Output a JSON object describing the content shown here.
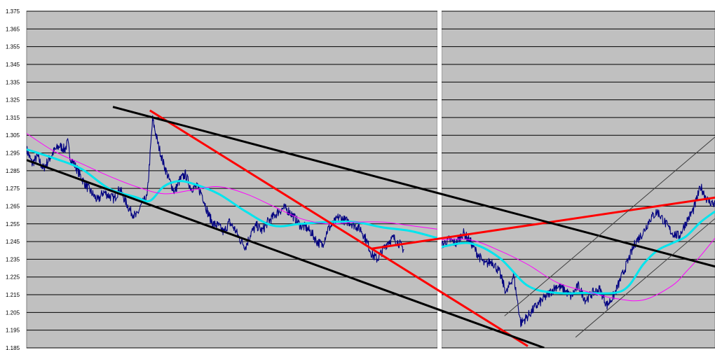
{
  "chart_data": {
    "type": "line",
    "title": "",
    "xlabel": "",
    "ylabel": "",
    "ylim": [
      1.185,
      1.375
    ],
    "y_ticks": [
      "1.375",
      "1.365",
      "1.355",
      "1.345",
      "1.335",
      "1.325",
      "1.315",
      "1.305",
      "1.295",
      "1.285",
      "1.275",
      "1.265",
      "1.255",
      "1.245",
      "1.235",
      "1.225",
      "1.215",
      "1.205",
      "1.195",
      "1.185"
    ],
    "grid": true,
    "legend": "none",
    "colors": {
      "plot_background": "#c0c0c0",
      "price": "#000080",
      "fast_average": "#00e5ee",
      "slow_average": "#ff00ff",
      "trendline_red": "#ff0000",
      "trendline_black": "#000000",
      "channel_thin": "#404040"
    },
    "panels": [
      {
        "name": "",
        "series": [
          {
            "role": "price",
            "x": [
              0,
              4,
              8,
              12,
              16,
              20,
              24,
              28,
              30,
              32,
              36,
              40,
              44,
              48,
              52,
              56,
              60,
              64,
              68,
              72,
              76,
              80,
              84,
              88,
              92,
              96,
              100,
              104,
              108,
              112,
              116,
              120,
              124,
              128,
              132,
              136,
              140,
              144,
              148,
              152,
              156,
              160,
              164,
              168,
              172,
              176,
              180,
              184,
              188,
              192,
              196,
              200,
              204,
              208,
              212,
              216,
              220,
              224,
              228,
              232,
              236,
              240,
              244,
              248,
              252,
              256,
              260,
              264,
              268,
              272,
              276,
              280,
              284,
              288,
              292,
              296,
              300
            ],
            "y": [
              1.297,
              1.289,
              1.293,
              1.286,
              1.291,
              1.296,
              1.299,
              1.297,
              1.301,
              1.292,
              1.287,
              1.281,
              1.276,
              1.272,
              1.268,
              1.273,
              1.271,
              1.269,
              1.275,
              1.268,
              1.262,
              1.259,
              1.266,
              1.27,
              1.314,
              1.3,
              1.289,
              1.28,
              1.273,
              1.28,
              1.283,
              1.275,
              1.276,
              1.272,
              1.262,
              1.255,
              1.254,
              1.25,
              1.256,
              1.252,
              1.246,
              1.242,
              1.25,
              1.254,
              1.251,
              1.256,
              1.259,
              1.262,
              1.264,
              1.262,
              1.258,
              1.254,
              1.253,
              1.25,
              1.245,
              1.243,
              1.252,
              1.255,
              1.259,
              1.257,
              1.256,
              1.254,
              1.252,
              1.246,
              1.238,
              1.235,
              1.24,
              1.245,
              1.247,
              1.244,
              1.24
            ]
          },
          {
            "role": "fast-average",
            "x": [
              0,
              20,
              40,
              60,
              80,
              90,
              100,
              110,
              120,
              140,
              160,
              180,
              200,
              220,
              240,
              260,
              280,
              300
            ],
            "y": [
              1.297,
              1.292,
              1.286,
              1.275,
              1.27,
              1.268,
              1.276,
              1.279,
              1.278,
              1.272,
              1.262,
              1.254,
              1.255,
              1.256,
              1.256,
              1.253,
              1.251,
              1.247
            ]
          },
          {
            "role": "slow-average",
            "x": [
              0,
              20,
              40,
              60,
              80,
              100,
              120,
              140,
              160,
              180,
              200,
              220,
              240,
              260,
              280,
              300
            ],
            "y": [
              1.306,
              1.296,
              1.289,
              1.282,
              1.276,
              1.272,
              1.274,
              1.276,
              1.272,
              1.265,
              1.258,
              1.255,
              1.256,
              1.256,
              1.254,
              1.252
            ]
          }
        ]
      },
      {
        "name": "",
        "series": [
          {
            "role": "price",
            "x": [
              0,
              5,
              10,
              15,
              20,
              25,
              30,
              35,
              40,
              45,
              50,
              55,
              60,
              65,
              70,
              75,
              80,
              85,
              90,
              95,
              100,
              105,
              110,
              115,
              120,
              125,
              130,
              135,
              140,
              145,
              150,
              155,
              160,
              165,
              170,
              175,
              180,
              185,
              190
            ],
            "y": [
              1.243,
              1.246,
              1.244,
              1.25,
              1.245,
              1.238,
              1.232,
              1.234,
              1.228,
              1.216,
              1.226,
              1.199,
              1.203,
              1.208,
              1.212,
              1.216,
              1.22,
              1.218,
              1.214,
              1.22,
              1.212,
              1.216,
              1.218,
              1.209,
              1.215,
              1.225,
              1.235,
              1.245,
              1.25,
              1.258,
              1.262,
              1.256,
              1.25,
              1.248,
              1.256,
              1.263,
              1.276,
              1.268,
              1.266
            ]
          },
          {
            "role": "fast-average",
            "x": [
              0,
              20,
              40,
              60,
              80,
              100,
              120,
              130,
              140,
              150,
              160,
              170,
              180,
              190
            ],
            "y": [
              1.242,
              1.244,
              1.236,
              1.22,
              1.216,
              1.216,
              1.216,
              1.22,
              1.232,
              1.24,
              1.244,
              1.248,
              1.256,
              1.262
            ]
          },
          {
            "role": "slow-average",
            "x": [
              0,
              20,
              40,
              60,
              80,
              100,
              120,
              140,
              160,
              170,
              180,
              190
            ],
            "y": [
              1.246,
              1.246,
              1.24,
              1.232,
              1.222,
              1.217,
              1.213,
              1.212,
              1.22,
              1.228,
              1.237,
              1.247
            ]
          }
        ]
      }
    ],
    "annotations": [
      {
        "type": "trendline",
        "color": "red",
        "panel": "left",
        "from": [
          0.3,
          1.319
        ],
        "to": [
          1.22,
          1.186
        ]
      },
      {
        "type": "trendline",
        "color": "red",
        "panel": "left",
        "from": [
          0.84,
          1.241
        ],
        "to": [
          2.0,
          1.281
        ]
      },
      {
        "type": "trendline",
        "color": "black",
        "panel": "left",
        "from": [
          0.21,
          1.321
        ],
        "to": [
          2.0,
          1.211
        ]
      },
      {
        "type": "trendline",
        "color": "black",
        "panel": "left",
        "from": [
          0.0,
          1.291
        ],
        "to": [
          1.26,
          1.185
        ]
      },
      {
        "type": "channel",
        "color": "gray",
        "panel": "right",
        "from": [
          0.23,
          1.203
        ],
        "to": [
          1.0,
          1.304
        ]
      },
      {
        "type": "channel",
        "color": "gray",
        "panel": "right",
        "from": [
          0.49,
          1.191
        ],
        "to": [
          1.0,
          1.258
        ]
      }
    ]
  }
}
